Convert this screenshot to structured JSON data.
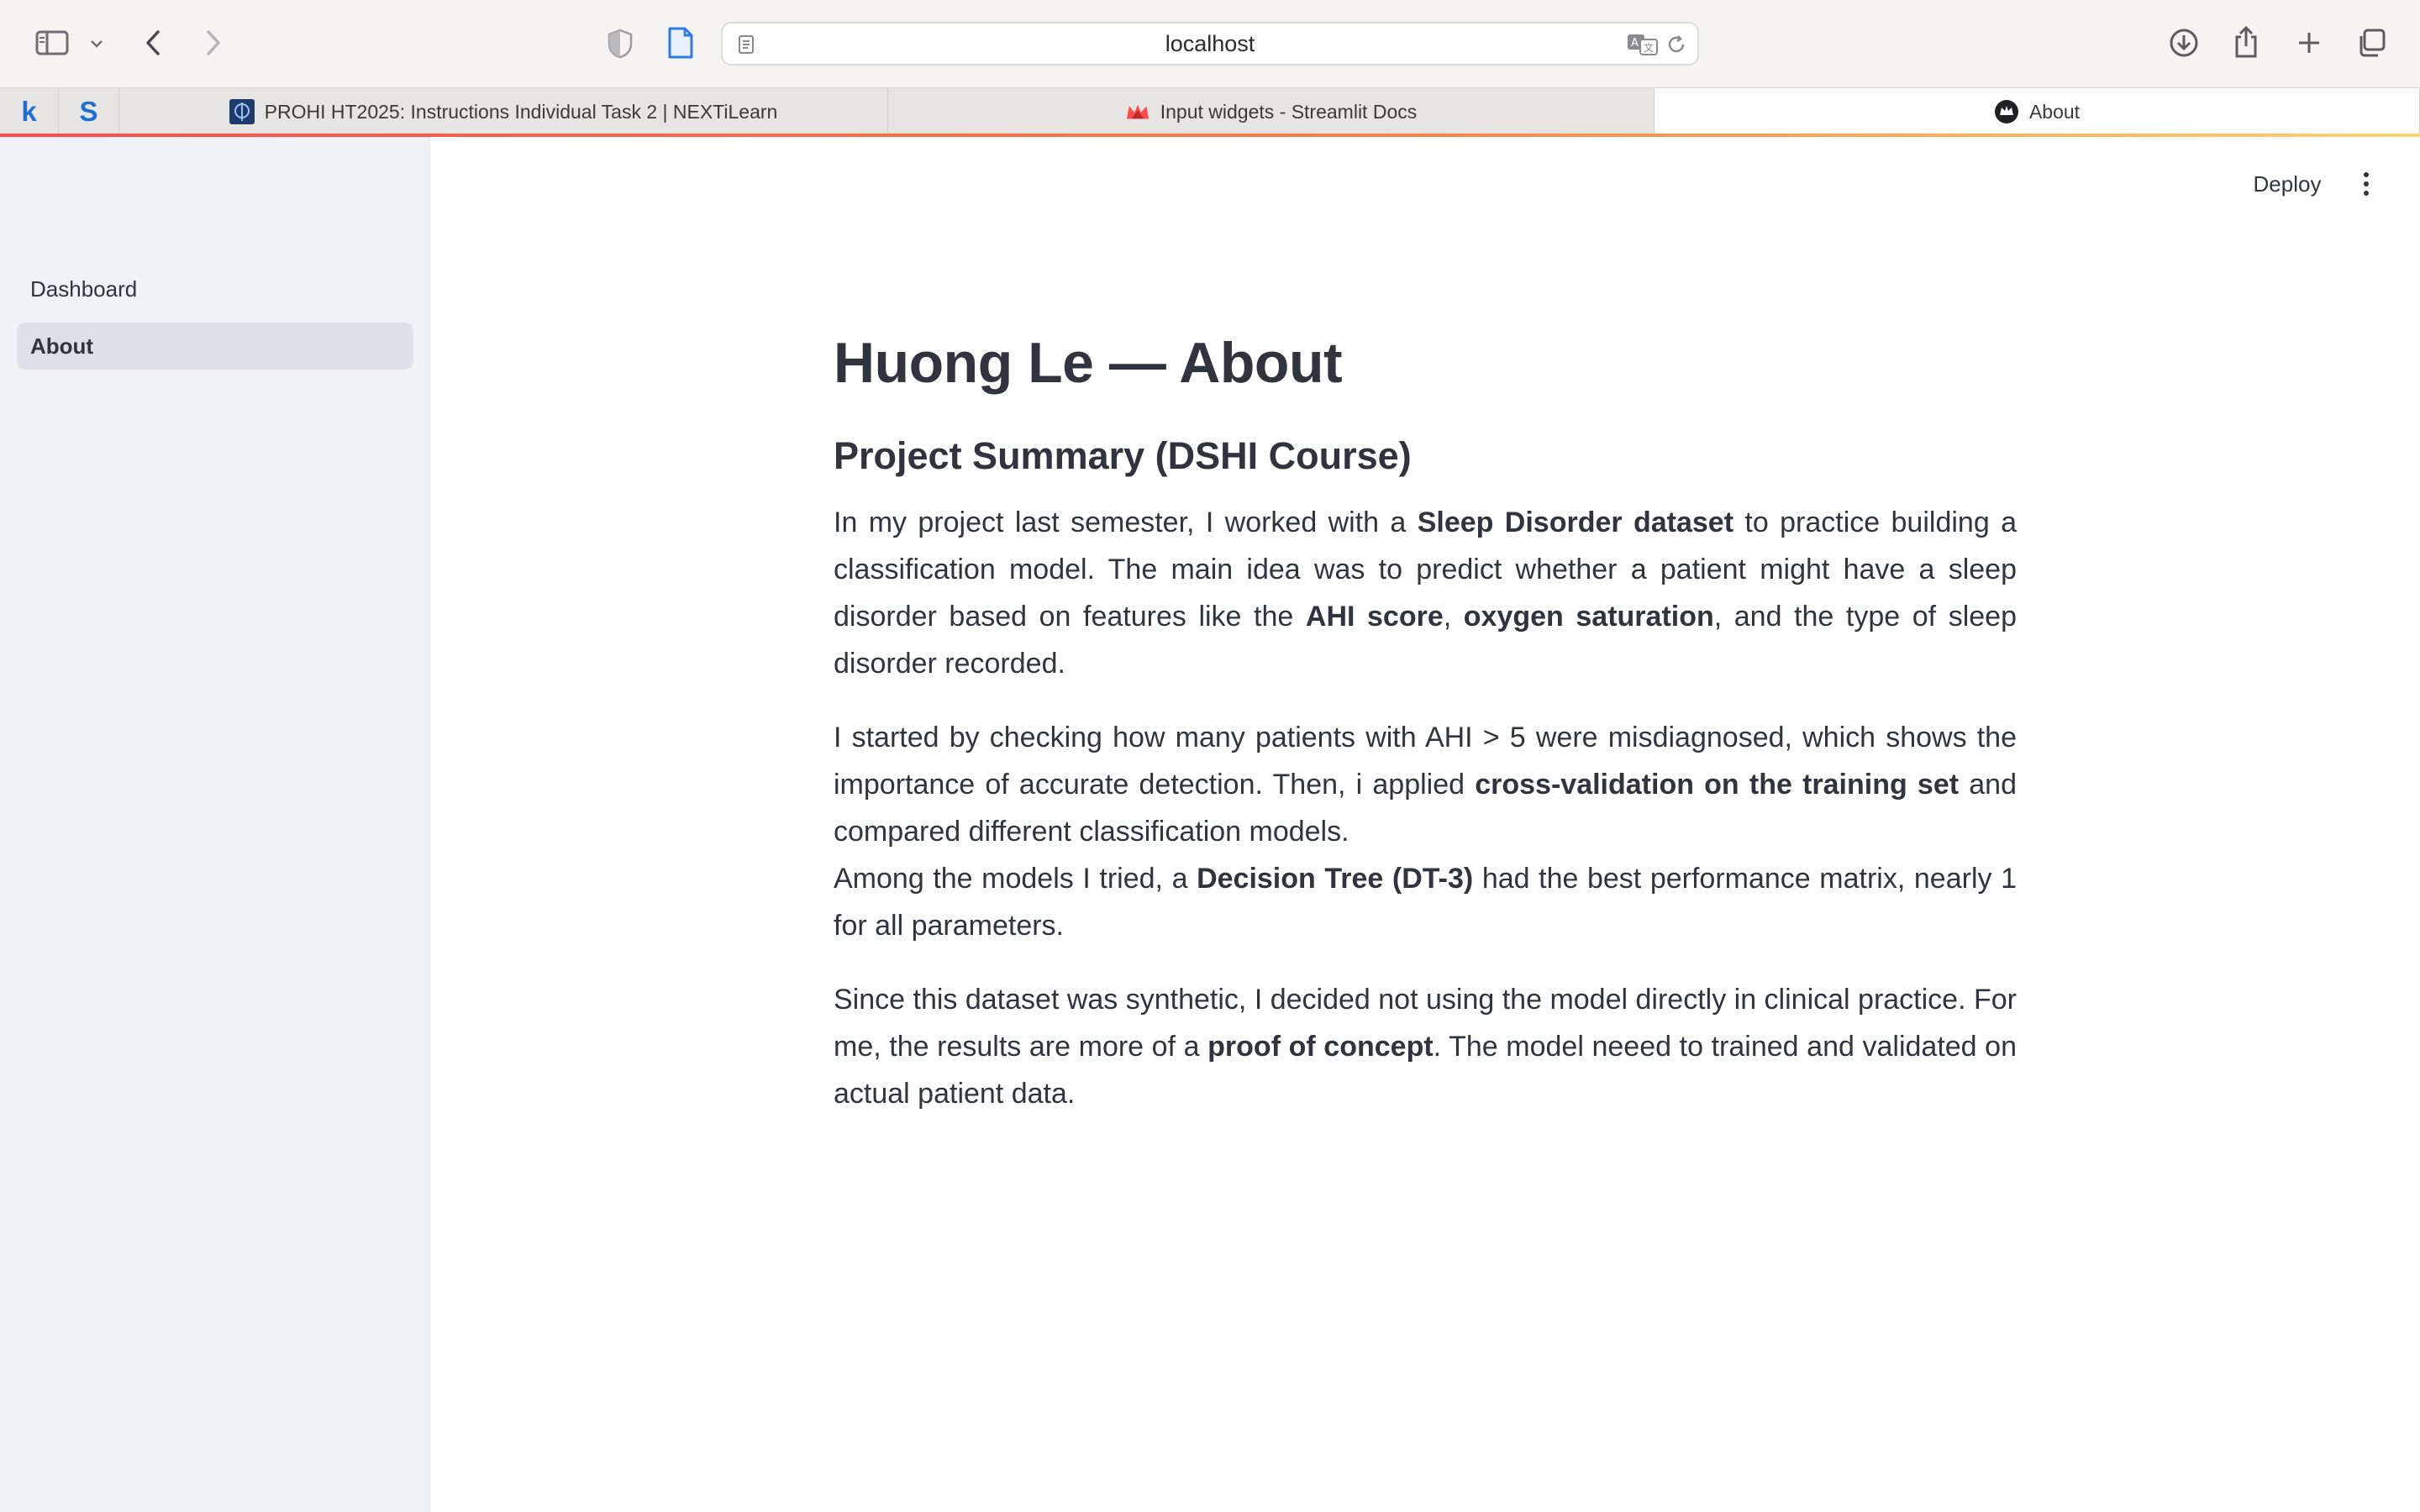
{
  "browser": {
    "url": "localhost",
    "tabs": [
      {
        "label": "PROHI HT2025: Instructions Individual Task 2 | NEXTiLearn",
        "active": false
      },
      {
        "label": "Input widgets - Streamlit Docs",
        "active": false
      },
      {
        "label": "About",
        "active": true
      }
    ],
    "pinned_tabs": [
      "k",
      "S"
    ],
    "icons": [
      "sidebar-toggle-icon",
      "chevron-down-icon",
      "back-arrow-icon",
      "forward-arrow-icon",
      "privacy-shield-icon",
      "page-icon",
      "reader-icon",
      "translate-icon",
      "reload-icon",
      "download-icon",
      "share-icon",
      "new-tab-plus-icon",
      "tab-overview-icon"
    ]
  },
  "app": {
    "deploy_label": "Deploy",
    "sidebar": {
      "items": [
        {
          "label": "Dashboard",
          "active": false
        },
        {
          "label": "About",
          "active": true
        }
      ]
    },
    "title": "Huong Le — About",
    "subtitle": "Project Summary (DSHI Course)",
    "p1": {
      "t1": "In my project last semester, I worked with a ",
      "b1": "Sleep Disorder dataset",
      "t2": " to practice building a classification model. The main idea was to predict whether a patient might have a sleep disorder based on features like the ",
      "b2": "AHI score",
      "t3": ", ",
      "b3": "oxygen saturation",
      "t4": ", and the type of sleep disorder recorded."
    },
    "p2": {
      "t1": "I started by checking how many patients with AHI > 5 were misdiagnosed, which shows the importance of accurate detection. Then, i applied ",
      "b1": "cross-validation on the training set",
      "t2": " and compared different classification models."
    },
    "p3": {
      "t1": "Among the models I tried, a ",
      "b1": "Decision Tree (DT-3)",
      "t2": " had the best performance matrix, nearly 1 for all parameters."
    },
    "p4": {
      "t1": "Since this dataset was synthetic, I decided not using the model directly in clinical practice. For me, the results are more of a ",
      "b1": "proof of concept",
      "t2": ". The model neeed to trained and validated on actual patient data."
    }
  },
  "colors": {
    "text": "#31333f",
    "sidebar_bg": "#f0f2f6",
    "active_nav_bg": "#dde0e9",
    "progress_start": "#ff4b4b",
    "progress_end": "#ffd36b"
  }
}
